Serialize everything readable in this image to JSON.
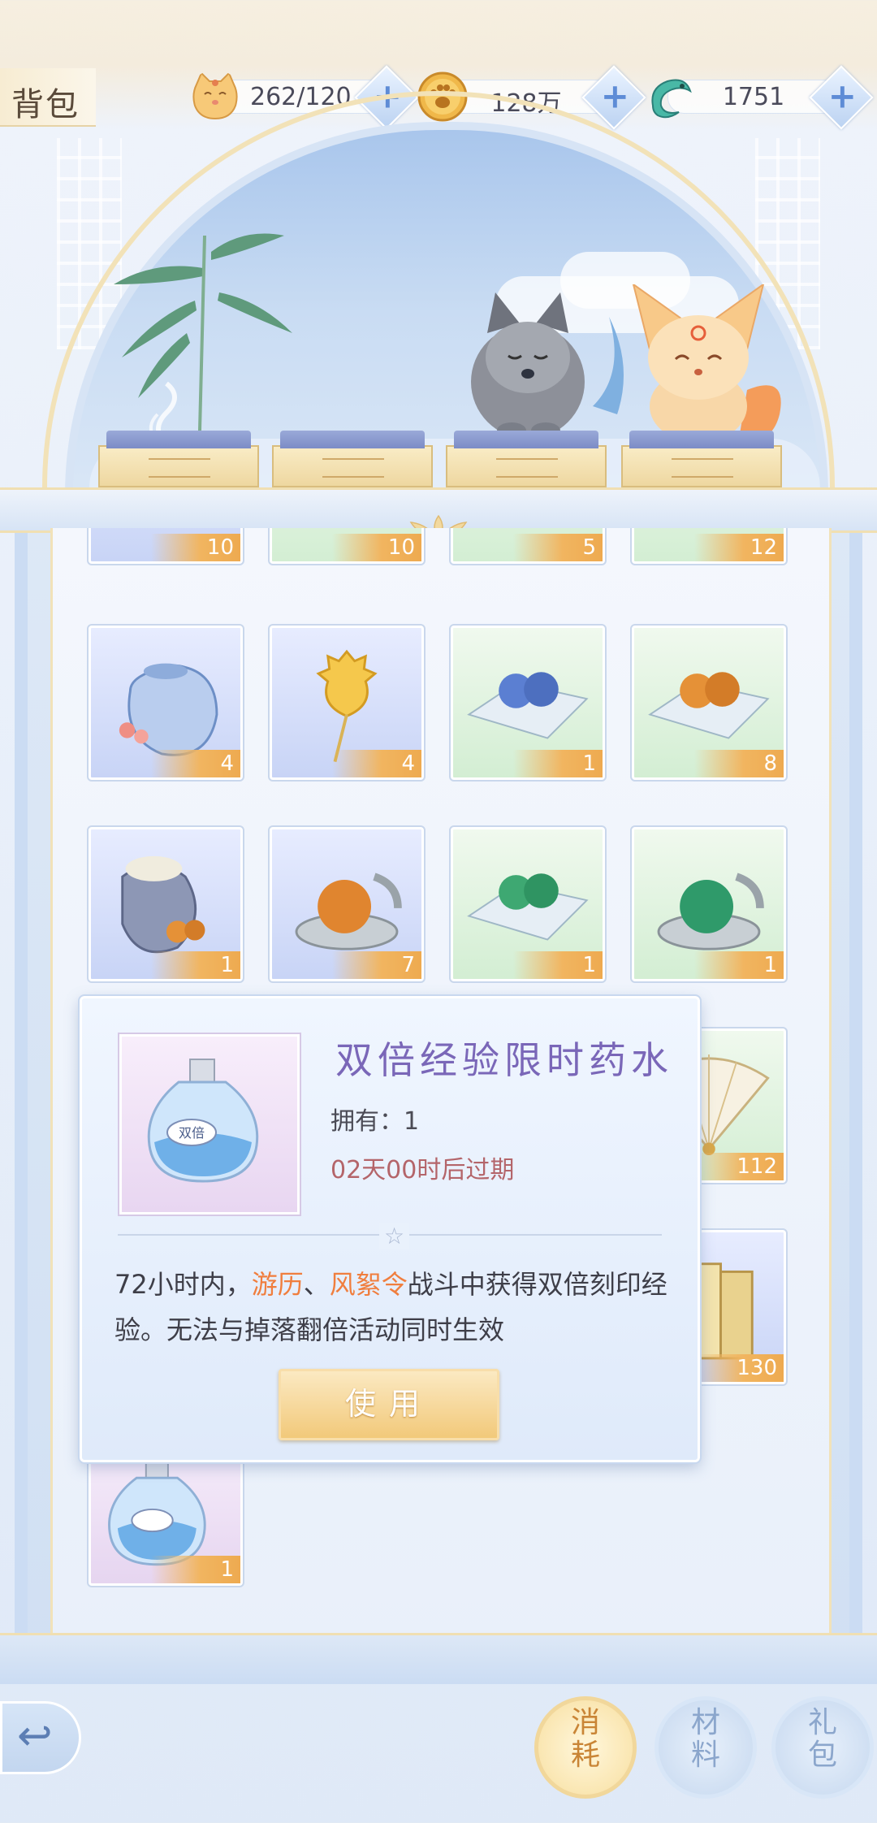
{
  "header": {
    "title": "背包",
    "resources": [
      {
        "icon": "cat-face-icon",
        "value": "262/120"
      },
      {
        "icon": "paw-coin-icon",
        "value": "128万"
      },
      {
        "icon": "jade-dragon-icon",
        "value": "1751"
      }
    ],
    "plus_label": "+"
  },
  "inventory": {
    "top_row_counts": [
      "10",
      "10",
      "5",
      "12"
    ],
    "items": [
      {
        "name": "lucky-bag-item",
        "count": "4"
      },
      {
        "name": "golden-sheep-lollipop-item",
        "count": "4"
      },
      {
        "name": "blue-pearls-item",
        "count": "1"
      },
      {
        "name": "orange-pearls-item",
        "count": "8"
      },
      {
        "name": "grey-pouch-item",
        "count": "1"
      },
      {
        "name": "orange-orb-dish-item",
        "count": "7"
      },
      {
        "name": "green-pearls-item",
        "count": "1"
      },
      {
        "name": "green-orb-dish-item",
        "count": "1"
      },
      {
        "name": "folding-fan-item",
        "count": "112"
      },
      {
        "name": "scroll-screen-item",
        "count": "130"
      },
      {
        "name": "double-potion-item",
        "count": "1"
      }
    ]
  },
  "tooltip": {
    "item_name": "双倍经验限时药水",
    "owned": "拥有：1",
    "expire": "02天00时后过期",
    "desc_prefix": "72小时内，",
    "desc_hl1": "游历",
    "desc_sep": "、",
    "desc_hl2": "风絮令",
    "desc_suffix": "战斗中获得双倍刻印经验。无法与掉落翻倍活动同时生效",
    "use_label": "使用",
    "potion_label": "双倍"
  },
  "bottom_tabs": [
    {
      "label": "消耗",
      "active": true
    },
    {
      "label": "材料",
      "active": false
    },
    {
      "label": "礼包",
      "active": false
    }
  ],
  "colors": {
    "accent_gold": "#f1b560",
    "title_purple": "#7a67b8",
    "highlight_orange": "#f07e3e",
    "expire_red": "#b4656a"
  }
}
